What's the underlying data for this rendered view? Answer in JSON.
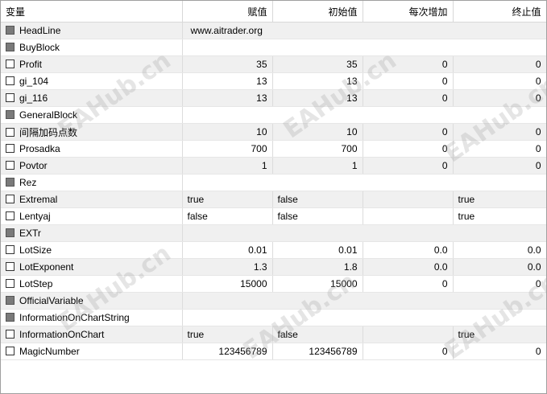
{
  "columns": [
    "变量",
    "赋值",
    "初始值",
    "每次增加",
    "终止值"
  ],
  "rows": [
    {
      "name": "HeadLine",
      "group": true,
      "cells": [
        "www.aitrader.org"
      ],
      "span": true
    },
    {
      "name": "BuyBlock",
      "group": true,
      "cells": [],
      "span": true
    },
    {
      "name": "Profit",
      "group": false,
      "cells": [
        "35",
        "35",
        "0",
        "0"
      ],
      "align": "num"
    },
    {
      "name": "gi_104",
      "group": false,
      "cells": [
        "13",
        "13",
        "0",
        "0"
      ],
      "align": "num"
    },
    {
      "name": "gi_116",
      "group": false,
      "cells": [
        "13",
        "13",
        "0",
        "0"
      ],
      "align": "num"
    },
    {
      "name": "GeneralBlock",
      "group": true,
      "cells": [],
      "span": true
    },
    {
      "name": "间隔加码点数",
      "group": false,
      "cells": [
        "10",
        "10",
        "0",
        "0"
      ],
      "align": "num"
    },
    {
      "name": "Prosadka",
      "group": false,
      "cells": [
        "700",
        "700",
        "0",
        "0"
      ],
      "align": "num"
    },
    {
      "name": "Povtor",
      "group": false,
      "cells": [
        "1",
        "1",
        "0",
        "0"
      ],
      "align": "num"
    },
    {
      "name": "Rez",
      "group": true,
      "cells": [],
      "span": true
    },
    {
      "name": "Extremal",
      "group": false,
      "cells": [
        "true",
        "false",
        "",
        "true"
      ],
      "align": "txt"
    },
    {
      "name": "Lentyaj",
      "group": false,
      "cells": [
        "false",
        "false",
        "",
        "true"
      ],
      "align": "txt"
    },
    {
      "name": "EXTr",
      "group": true,
      "cells": [],
      "span": true
    },
    {
      "name": "LotSize",
      "group": false,
      "cells": [
        "0.01",
        "0.01",
        "0.0",
        "0.0"
      ],
      "align": "num"
    },
    {
      "name": "LotExponent",
      "group": false,
      "cells": [
        "1.3",
        "1.8",
        "0.0",
        "0.0"
      ],
      "align": "num"
    },
    {
      "name": "LotStep",
      "group": false,
      "cells": [
        "15000",
        "15000",
        "0",
        "0"
      ],
      "align": "num"
    },
    {
      "name": "OfficialVariable",
      "group": true,
      "cells": [],
      "span": true
    },
    {
      "name": "InformationOnChartString",
      "group": true,
      "cells": [],
      "span": true
    },
    {
      "name": "InformationOnChart",
      "group": false,
      "cells": [
        "true",
        "false",
        "",
        "true"
      ],
      "align": "txt"
    },
    {
      "name": "MagicNumber",
      "group": false,
      "cells": [
        "123456789",
        "123456789",
        "0",
        "0"
      ],
      "align": "num"
    }
  ],
  "watermark": "EAHub.cn"
}
